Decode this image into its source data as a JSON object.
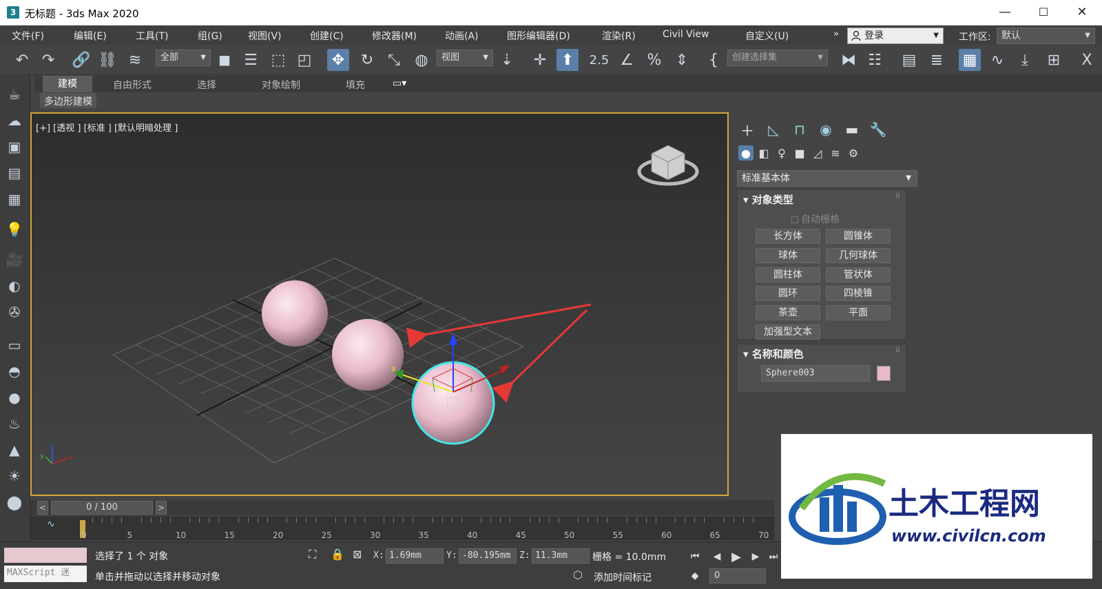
{
  "window": {
    "app_icon": "3",
    "title": "无标题 - 3ds Max 2020",
    "minimize": "—",
    "maximize": "☐",
    "close": "✕"
  },
  "menu": {
    "items": [
      "文件(F)",
      "编辑(E)",
      "工具(T)",
      "组(G)",
      "视图(V)",
      "创建(C)",
      "修改器(M)",
      "动画(A)",
      "图形编辑器(D)",
      "渲染(R)",
      "Civil View",
      "自定义(U)"
    ],
    "overflow": "»",
    "login": "登录",
    "workspace_label": "工作区:",
    "workspace_value": "默认"
  },
  "toolbar": {
    "selection_filter": "全部",
    "reference_coord": "视图",
    "named_selection_placeholder": "创建选择集",
    "snap_label": "2.5",
    "x_icon": "X"
  },
  "ribbon": {
    "tabs": [
      "建模",
      "自由形式",
      "选择",
      "对象绘制",
      "填充"
    ],
    "active_tab": "建模",
    "sub_label": "多边形建模"
  },
  "viewport": {
    "label": "[+] [透视 ] [标准 ] [默认明暗处理 ]",
    "axis_x": "x",
    "axis_z": "z",
    "axis_y": "y"
  },
  "command_panel": {
    "category": "标准基本体",
    "object_type_title": "对象类型",
    "auto_grid": "自动栅格",
    "buttons": [
      "长方体",
      "圆锥体",
      "球体",
      "几何球体",
      "圆柱体",
      "管状体",
      "圆环",
      "四棱锥",
      "茶壶",
      "平面",
      "加强型文本"
    ],
    "name_color_title": "名称和颜色",
    "object_name": "Sphere003",
    "object_color": "#e8b9cb"
  },
  "timeline": {
    "frame_display": "0 / 100",
    "prev": "<",
    "next": ">",
    "ticks": [
      "0",
      "5",
      "10",
      "15",
      "20",
      "25",
      "30",
      "35",
      "40",
      "45",
      "50",
      "55",
      "60",
      "65",
      "70"
    ]
  },
  "status": {
    "maxscript_placeholder": "MAXScript 迷",
    "line1": "选择了 1 个 对象",
    "line2": "单击并拖动以选择并移动对象",
    "x_label": "X:",
    "x_value": "1.69mm",
    "y_label": "Y:",
    "y_value": "-80.195mm",
    "z_label": "Z:",
    "z_value": "11.3mm",
    "grid": "栅格 = 10.0mm",
    "add_time_tag": "添加时间标记",
    "frame_value": "0"
  },
  "watermark": {
    "name": "土木工程网",
    "url": "www.civilcn.com"
  },
  "colors": {
    "accent": "#5a7fa8",
    "viewport_border": "#d4a93a",
    "sphere": "#e8b9cb",
    "selection": "#45e6e6",
    "annotation_arrow": "#e53935"
  }
}
